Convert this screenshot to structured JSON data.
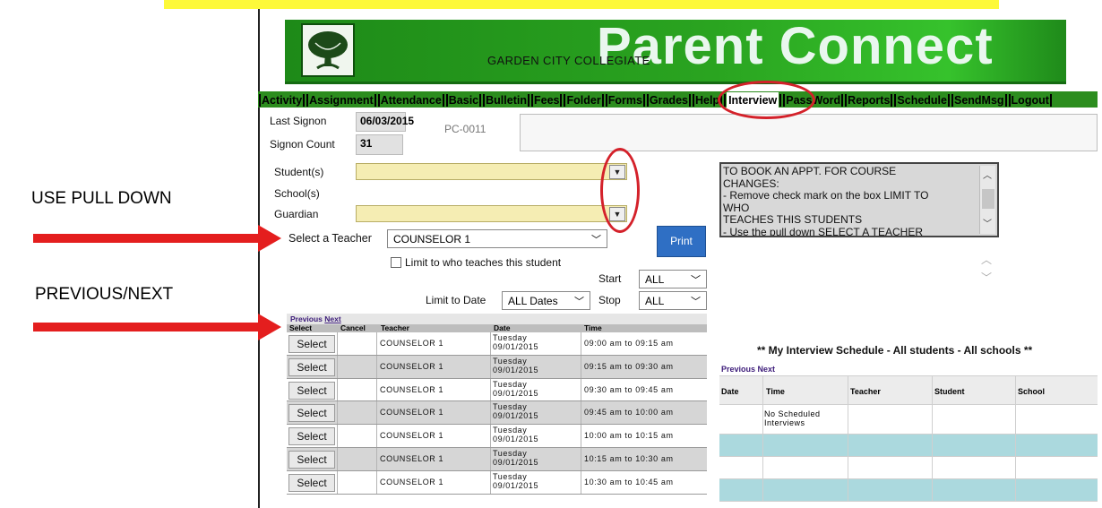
{
  "annotations": {
    "use_pull_down": "USE PULL DOWN",
    "previous_next": "PREVIOUS/NEXT"
  },
  "banner": {
    "title": "Parent Connect",
    "school": "GARDEN CITY  COLLEGIATE"
  },
  "menu": [
    "Activity",
    "Assignment",
    "Attendance",
    "Basic",
    "Bulletin",
    "Fees",
    "Folder",
    "Forms",
    "Grades",
    "Help",
    "Interview",
    "PassWord",
    "Reports",
    "Schedule",
    "SendMsg",
    "Logout"
  ],
  "menu_active": "Interview",
  "signon": {
    "last_label": "Last Signon",
    "last_value": "06/03/2015",
    "code": "PC-0011",
    "count_label": "Signon Count",
    "count_value": "31"
  },
  "form": {
    "student_label": "Student(s)",
    "school_label": "School(s)",
    "guardian_label": "Guardian",
    "teacher_label": "Select a Teacher",
    "teacher_value": "COUNSELOR 1",
    "print_label": "Print",
    "limit_label": "Limit to who teaches this student",
    "start_label": "Start",
    "start_value": "ALL",
    "stop_label": "Stop",
    "stop_value": "ALL",
    "limit_date_label": "Limit to Date",
    "limit_date_value": "ALL Dates"
  },
  "message": "TO BOOK AN APPT. FOR COURSE\nCHANGES:\n- Remove check mark on the box LIMIT TO\nWHO\nTEACHES THIS STUDENTS\n- Use the pull down SELECT A TEACHER",
  "grid": {
    "nav_previous": "Previous",
    "nav_next": "Next",
    "headers": [
      "Select",
      "Cancel",
      "Teacher",
      "Date",
      "Time"
    ],
    "select_label": "Select",
    "rows": [
      {
        "teacher": "COUNSELOR 1",
        "day": "Tuesday",
        "date": "09/01/2015",
        "time": "09:00 am to 09:15 am"
      },
      {
        "teacher": "COUNSELOR 1",
        "day": "Tuesday",
        "date": "09/01/2015",
        "time": "09:15 am to 09:30 am"
      },
      {
        "teacher": "COUNSELOR 1",
        "day": "Tuesday",
        "date": "09/01/2015",
        "time": "09:30 am to 09:45 am"
      },
      {
        "teacher": "COUNSELOR 1",
        "day": "Tuesday",
        "date": "09/01/2015",
        "time": "09:45 am to 10:00 am"
      },
      {
        "teacher": "COUNSELOR 1",
        "day": "Tuesday",
        "date": "09/01/2015",
        "time": "10:00 am to 10:15 am"
      },
      {
        "teacher": "COUNSELOR 1",
        "day": "Tuesday",
        "date": "09/01/2015",
        "time": "10:15 am to 10:30 am"
      },
      {
        "teacher": "COUNSELOR 1",
        "day": "Tuesday",
        "date": "09/01/2015",
        "time": "10:30 am to 10:45 am"
      }
    ]
  },
  "schedule": {
    "title": "** My Interview Schedule - All students - All schools **",
    "nav_previous": "Previous",
    "nav_next": "Next",
    "headers": [
      "Date",
      "Time",
      "Teacher",
      "Student",
      "School"
    ],
    "empty_text_1": "No Scheduled",
    "empty_text_2": "Interviews"
  },
  "colors": {
    "highlight": "#fdf93a",
    "arrow": "#e41e1e",
    "banner_green": "#2aa420",
    "menu_green": "#2c8d1e",
    "print_blue": "#2f6fc4",
    "teal_row": "#abd9de"
  }
}
